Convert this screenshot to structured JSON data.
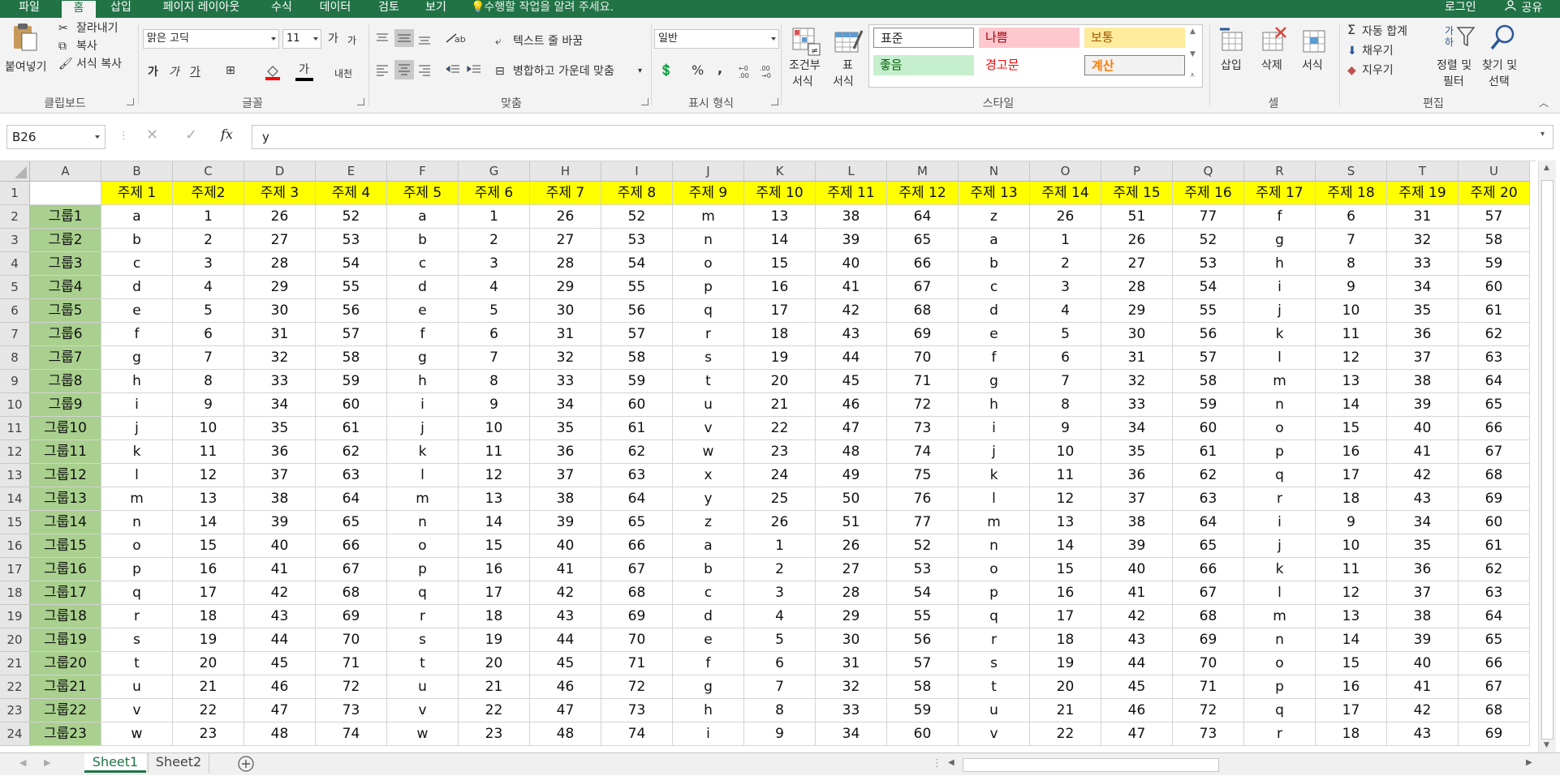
{
  "tabs": [
    {
      "label": "파일",
      "active": false
    },
    {
      "label": "홈",
      "active": true
    },
    {
      "label": "삽입",
      "active": false
    },
    {
      "label": "페이지 레이아웃",
      "active": false
    },
    {
      "label": "수식",
      "active": false
    },
    {
      "label": "데이터",
      "active": false
    },
    {
      "label": "검토",
      "active": false
    },
    {
      "label": "보기",
      "active": false
    }
  ],
  "tell_me": "수행할 작업을 알려 주세요.",
  "login": "로그인",
  "share": "공유",
  "ribbon": {
    "clipboard": {
      "paste": "붙여넣기",
      "cut": "잘라내기",
      "copy": "복사",
      "format_painter": "서식 복사",
      "group": "클립보드"
    },
    "font": {
      "name": "맑은 고딕",
      "size": "11",
      "bold": "가",
      "italic": "가",
      "underline": "가",
      "grow": "가",
      "shrink": "가",
      "font_color": "가",
      "phonetic": "내천",
      "group": "글꼴"
    },
    "alignment": {
      "wrap": "텍스트 줄 바꿈",
      "merge": "병합하고 가운데 맞춤",
      "group": "맞춤"
    },
    "number": {
      "format": "일반",
      "percent": "%",
      "comma": ",",
      "group": "표시 형식"
    },
    "styles": {
      "conditional": [
        "조건부",
        "서식"
      ],
      "table": [
        "표",
        "서식"
      ],
      "cells": [
        {
          "label": "표준",
          "bg": "#ffffff",
          "color": "#000000"
        },
        {
          "label": "나쁨",
          "bg": "#ffc7ce",
          "color": "#9c0006"
        },
        {
          "label": "보통",
          "bg": "#ffeb9c",
          "color": "#9c5700"
        },
        {
          "label": "좋음",
          "bg": "#c6efce",
          "color": "#006100"
        },
        {
          "label": "경고문",
          "bg": "#f3f3f3",
          "color": "#ff0000"
        },
        {
          "label": "계산",
          "bg": "#f2f2f2",
          "color": "#fa7d00"
        }
      ],
      "group": "스타일"
    },
    "cells_group": {
      "insert": "삽입",
      "delete": "삭제",
      "format": "서식",
      "group": "셀"
    },
    "editing": {
      "autosum": "자동 합계",
      "fill": "채우기",
      "clear": "지우기",
      "sort_filter": [
        "정렬 및",
        "필터"
      ],
      "find_select": [
        "찾기 및",
        "선택"
      ],
      "group": "편집"
    }
  },
  "formula_bar": {
    "name_box": "B26",
    "content": "y",
    "fx": "fx"
  },
  "columns": [
    "A",
    "B",
    "C",
    "D",
    "E",
    "F",
    "G",
    "H",
    "I",
    "J",
    "K",
    "L",
    "M",
    "N",
    "O",
    "P",
    "Q",
    "R",
    "S",
    "T",
    "U"
  ],
  "header_row": [
    "",
    "주제 1",
    "주제2",
    "주제 3",
    "주제 4",
    "주제 5",
    "주제 6",
    "주제 7",
    "주제 8",
    "주제 9",
    "주제 10",
    "주제 11",
    "주제 12",
    "주제 13",
    "주제 14",
    "주제 15",
    "주제 16",
    "주제 17",
    "주제 18",
    "주제 19",
    "주제 20"
  ],
  "rows": [
    [
      "그룹1",
      "a",
      "1",
      "26",
      "52",
      "a",
      "1",
      "26",
      "52",
      "m",
      "13",
      "38",
      "64",
      "z",
      "26",
      "51",
      "77",
      "f",
      "6",
      "31",
      "57"
    ],
    [
      "그룹2",
      "b",
      "2",
      "27",
      "53",
      "b",
      "2",
      "27",
      "53",
      "n",
      "14",
      "39",
      "65",
      "a",
      "1",
      "26",
      "52",
      "g",
      "7",
      "32",
      "58"
    ],
    [
      "그룹3",
      "c",
      "3",
      "28",
      "54",
      "c",
      "3",
      "28",
      "54",
      "o",
      "15",
      "40",
      "66",
      "b",
      "2",
      "27",
      "53",
      "h",
      "8",
      "33",
      "59"
    ],
    [
      "그룹4",
      "d",
      "4",
      "29",
      "55",
      "d",
      "4",
      "29",
      "55",
      "p",
      "16",
      "41",
      "67",
      "c",
      "3",
      "28",
      "54",
      "i",
      "9",
      "34",
      "60"
    ],
    [
      "그룹5",
      "e",
      "5",
      "30",
      "56",
      "e",
      "5",
      "30",
      "56",
      "q",
      "17",
      "42",
      "68",
      "d",
      "4",
      "29",
      "55",
      "j",
      "10",
      "35",
      "61"
    ],
    [
      "그룹6",
      "f",
      "6",
      "31",
      "57",
      "f",
      "6",
      "31",
      "57",
      "r",
      "18",
      "43",
      "69",
      "e",
      "5",
      "30",
      "56",
      "k",
      "11",
      "36",
      "62"
    ],
    [
      "그룹7",
      "g",
      "7",
      "32",
      "58",
      "g",
      "7",
      "32",
      "58",
      "s",
      "19",
      "44",
      "70",
      "f",
      "6",
      "31",
      "57",
      "l",
      "12",
      "37",
      "63"
    ],
    [
      "그룹8",
      "h",
      "8",
      "33",
      "59",
      "h",
      "8",
      "33",
      "59",
      "t",
      "20",
      "45",
      "71",
      "g",
      "7",
      "32",
      "58",
      "m",
      "13",
      "38",
      "64"
    ],
    [
      "그룹9",
      "i",
      "9",
      "34",
      "60",
      "i",
      "9",
      "34",
      "60",
      "u",
      "21",
      "46",
      "72",
      "h",
      "8",
      "33",
      "59",
      "n",
      "14",
      "39",
      "65"
    ],
    [
      "그룹10",
      "j",
      "10",
      "35",
      "61",
      "j",
      "10",
      "35",
      "61",
      "v",
      "22",
      "47",
      "73",
      "i",
      "9",
      "34",
      "60",
      "o",
      "15",
      "40",
      "66"
    ],
    [
      "그룹11",
      "k",
      "11",
      "36",
      "62",
      "k",
      "11",
      "36",
      "62",
      "w",
      "23",
      "48",
      "74",
      "j",
      "10",
      "35",
      "61",
      "p",
      "16",
      "41",
      "67"
    ],
    [
      "그룹12",
      "l",
      "12",
      "37",
      "63",
      "l",
      "12",
      "37",
      "63",
      "x",
      "24",
      "49",
      "75",
      "k",
      "11",
      "36",
      "62",
      "q",
      "17",
      "42",
      "68"
    ],
    [
      "그룹13",
      "m",
      "13",
      "38",
      "64",
      "m",
      "13",
      "38",
      "64",
      "y",
      "25",
      "50",
      "76",
      "l",
      "12",
      "37",
      "63",
      "r",
      "18",
      "43",
      "69"
    ],
    [
      "그룹14",
      "n",
      "14",
      "39",
      "65",
      "n",
      "14",
      "39",
      "65",
      "z",
      "26",
      "51",
      "77",
      "m",
      "13",
      "38",
      "64",
      "i",
      "9",
      "34",
      "60"
    ],
    [
      "그룹15",
      "o",
      "15",
      "40",
      "66",
      "o",
      "15",
      "40",
      "66",
      "a",
      "1",
      "26",
      "52",
      "n",
      "14",
      "39",
      "65",
      "j",
      "10",
      "35",
      "61"
    ],
    [
      "그룹16",
      "p",
      "16",
      "41",
      "67",
      "p",
      "16",
      "41",
      "67",
      "b",
      "2",
      "27",
      "53",
      "o",
      "15",
      "40",
      "66",
      "k",
      "11",
      "36",
      "62"
    ],
    [
      "그룹17",
      "q",
      "17",
      "42",
      "68",
      "q",
      "17",
      "42",
      "68",
      "c",
      "3",
      "28",
      "54",
      "p",
      "16",
      "41",
      "67",
      "l",
      "12",
      "37",
      "63"
    ],
    [
      "그룹18",
      "r",
      "18",
      "43",
      "69",
      "r",
      "18",
      "43",
      "69",
      "d",
      "4",
      "29",
      "55",
      "q",
      "17",
      "42",
      "68",
      "m",
      "13",
      "38",
      "64"
    ],
    [
      "그룹19",
      "s",
      "19",
      "44",
      "70",
      "s",
      "19",
      "44",
      "70",
      "e",
      "5",
      "30",
      "56",
      "r",
      "18",
      "43",
      "69",
      "n",
      "14",
      "39",
      "65"
    ],
    [
      "그룹20",
      "t",
      "20",
      "45",
      "71",
      "t",
      "20",
      "45",
      "71",
      "f",
      "6",
      "31",
      "57",
      "s",
      "19",
      "44",
      "70",
      "o",
      "15",
      "40",
      "66"
    ],
    [
      "그룹21",
      "u",
      "21",
      "46",
      "72",
      "u",
      "21",
      "46",
      "72",
      "g",
      "7",
      "32",
      "58",
      "t",
      "20",
      "45",
      "71",
      "p",
      "16",
      "41",
      "67"
    ],
    [
      "그룹22",
      "v",
      "22",
      "47",
      "73",
      "v",
      "22",
      "47",
      "73",
      "h",
      "8",
      "33",
      "59",
      "u",
      "21",
      "46",
      "72",
      "q",
      "17",
      "42",
      "68"
    ],
    [
      "그룹23",
      "w",
      "23",
      "48",
      "74",
      "w",
      "23",
      "48",
      "74",
      "i",
      "9",
      "34",
      "60",
      "v",
      "22",
      "47",
      "73",
      "r",
      "18",
      "43",
      "69"
    ]
  ],
  "colors": {
    "accent": "#217346",
    "header_fill": "#ffff00",
    "group_fill": "#a9d08e"
  },
  "sheets": [
    {
      "name": "Sheet1",
      "active": true
    },
    {
      "name": "Sheet2",
      "active": false
    }
  ]
}
